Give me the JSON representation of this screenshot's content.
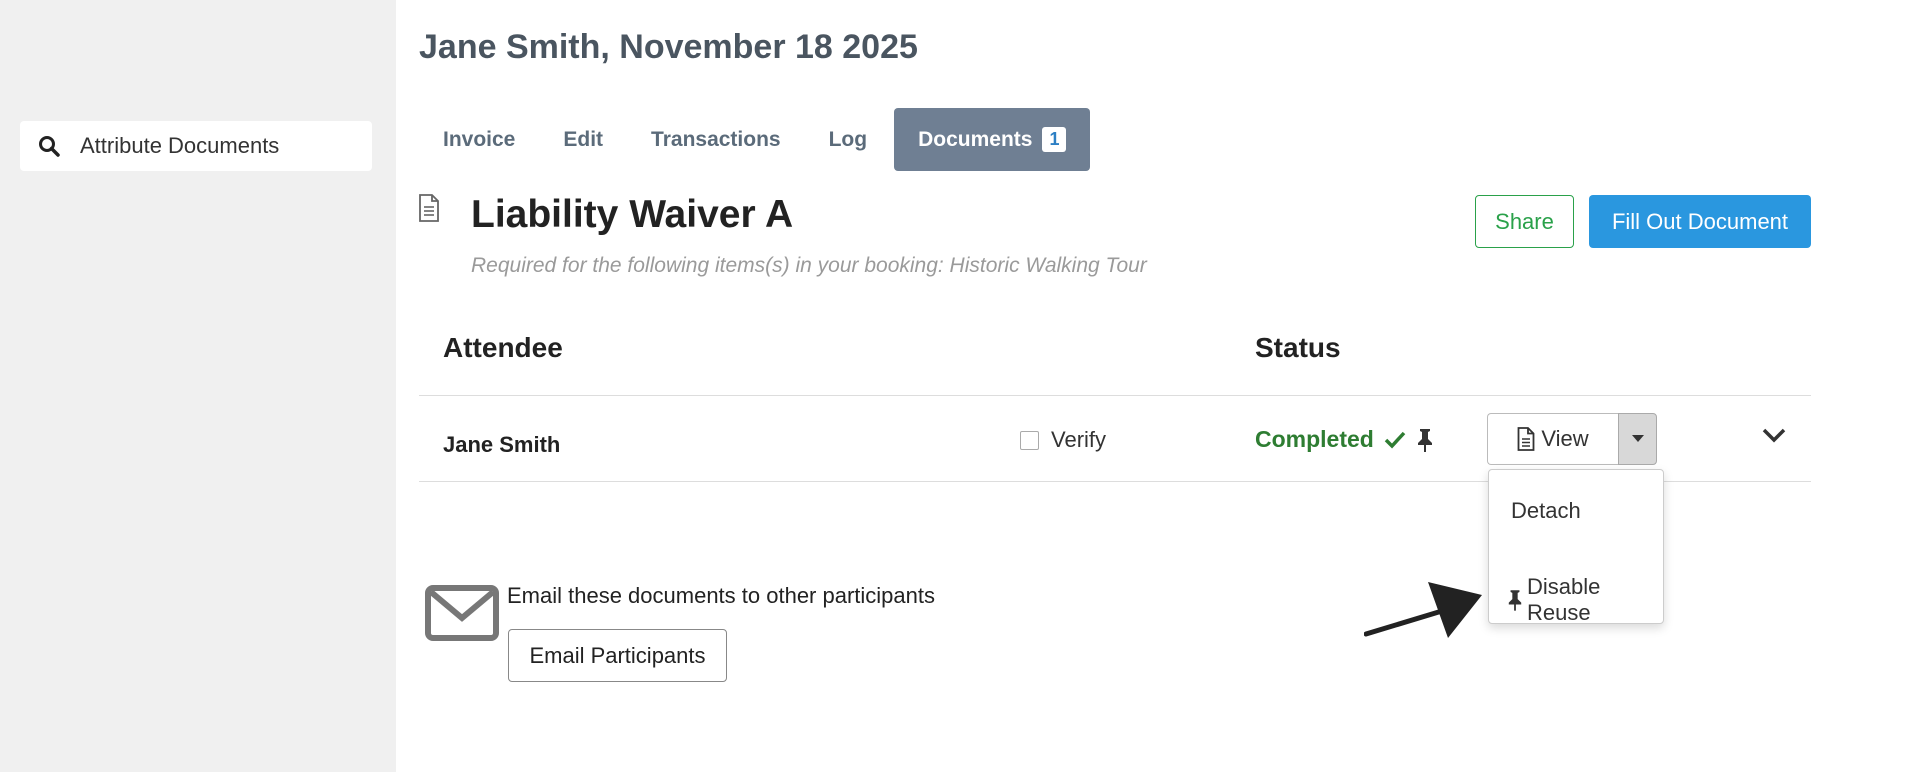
{
  "sidebar": {
    "search_label": "Attribute Documents"
  },
  "header": {
    "title": "Jane Smith, November 18 2025"
  },
  "tabs": [
    {
      "label": "Invoice"
    },
    {
      "label": "Edit"
    },
    {
      "label": "Transactions"
    },
    {
      "label": "Log"
    },
    {
      "label": "Documents",
      "badge": "1",
      "active": true
    }
  ],
  "document": {
    "title": "Liability Waiver A",
    "subtitle": "Required for the following items(s) in your booking: Historic Walking Tour",
    "share_label": "Share",
    "fill_label": "Fill Out Document"
  },
  "table": {
    "headers": [
      "Attendee",
      "Status"
    ],
    "rows": [
      {
        "attendee": "Jane Smith",
        "verify_label": "Verify",
        "status": "Completed",
        "view_label": "View"
      }
    ]
  },
  "dropdown": {
    "items": [
      "Detach",
      "Disable Reuse"
    ]
  },
  "email": {
    "text": "Email these documents to other participants",
    "button_label": "Email Participants"
  },
  "colors": {
    "accent_blue": "#2a97df",
    "success_green": "#2e7d32",
    "share_green": "#2aa14a",
    "active_tab": "#6f7f93"
  }
}
